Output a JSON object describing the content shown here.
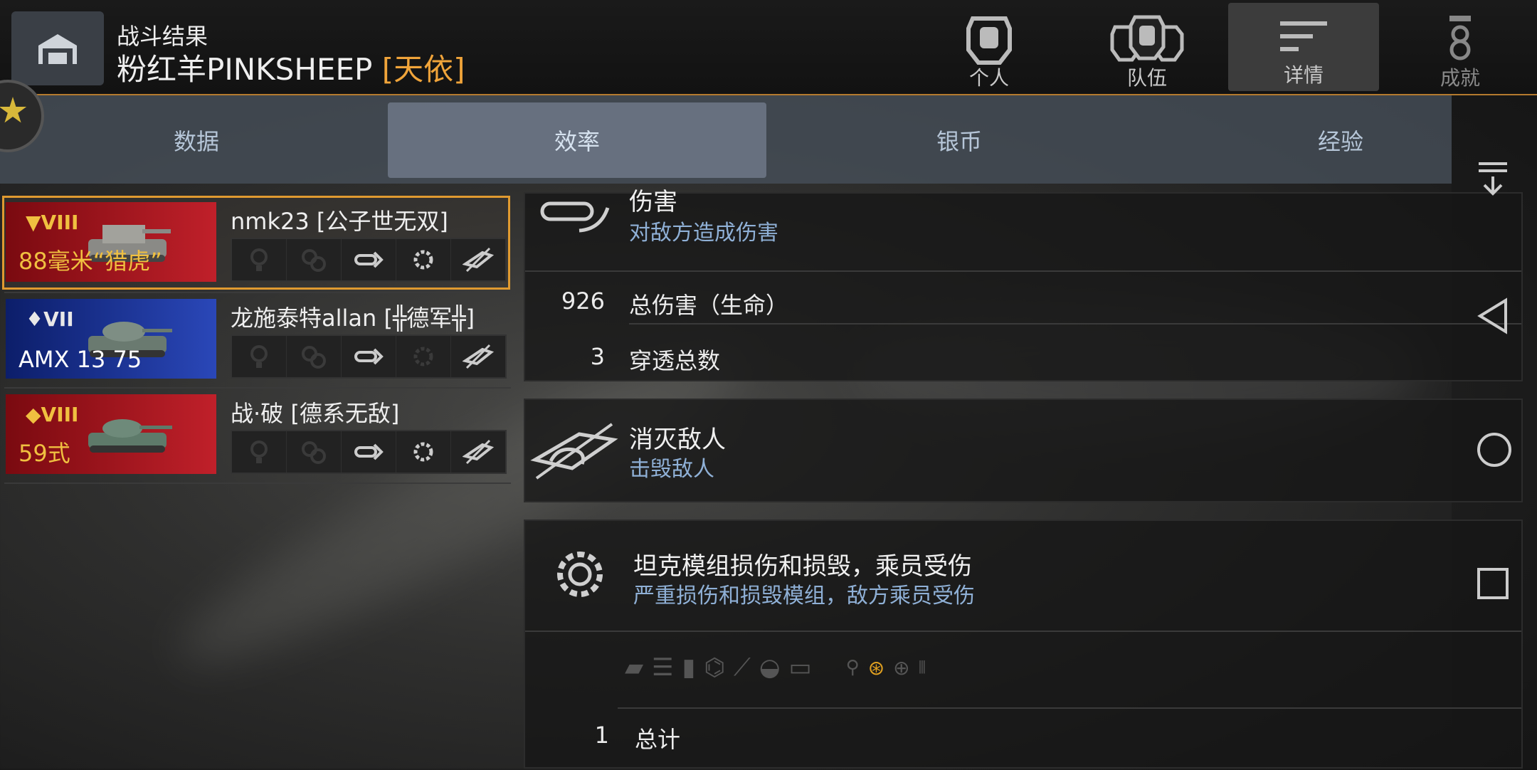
{
  "header": {
    "subtitle": "战斗结果",
    "player_name": "粉红羊PINKSHEEP",
    "player_clan": "[天依]",
    "nav": [
      {
        "label": "个人",
        "icon": "personal-icon"
      },
      {
        "label": "队伍",
        "icon": "team-icon"
      },
      {
        "label": "详情",
        "icon": "details-icon"
      },
      {
        "label": "成就",
        "icon": "achievements-icon"
      }
    ]
  },
  "tabs": [
    "数据",
    "效率",
    "银币",
    "经验"
  ],
  "players": [
    {
      "tier": "VIII",
      "vehicle": "88毫米“猎虎”",
      "name": "nmk23 [公子世无双]",
      "flag": "red"
    },
    {
      "tier": "VII",
      "vehicle": "AMX 13 75",
      "name": "龙施泰特allan [╬德军╬]",
      "flag": "blue"
    },
    {
      "tier": "VIII",
      "vehicle": "59式",
      "name": "战·破 [德系无敌]",
      "flag": "red"
    }
  ],
  "panels": {
    "damage": {
      "title": "伤害",
      "subtitle": "对敌方造成伤害",
      "rows": [
        {
          "value": "926",
          "label": "总伤害（生命）"
        },
        {
          "value": "3",
          "label": "穿透总数"
        }
      ]
    },
    "destroy": {
      "title": "消灭敌人",
      "subtitle": "击毁敌人"
    },
    "modules": {
      "title": "坦克模组损伤和损毁，乘员受伤",
      "subtitle": "严重损伤和损毁模组，敌方乘员受伤",
      "total_value": "1",
      "total_label": "总计"
    }
  },
  "colors": {
    "accent": "#e09a30",
    "subtext": "#8fb0d6"
  }
}
